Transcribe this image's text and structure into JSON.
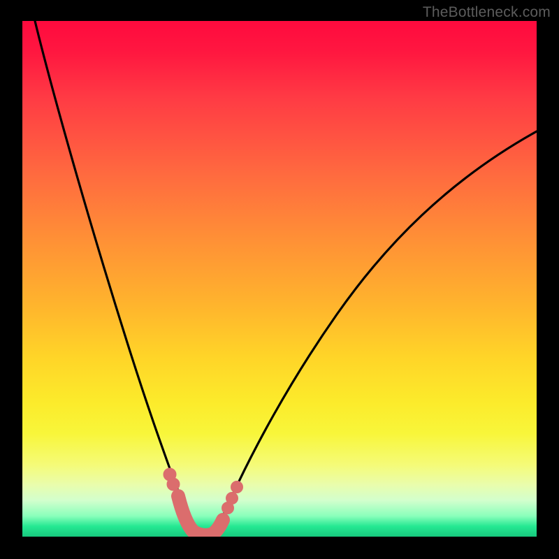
{
  "watermark": "TheBottleneck.com",
  "chart_data": {
    "type": "line",
    "title": "",
    "xlabel": "",
    "ylabel": "",
    "xlim": [
      0,
      100
    ],
    "ylim": [
      0,
      100
    ],
    "series": [
      {
        "name": "bottleneck-curve",
        "x": [
          2,
          5,
          10,
          15,
          20,
          25,
          27,
          29,
          30,
          31,
          32,
          33,
          34,
          35,
          36,
          38,
          42,
          50,
          60,
          70,
          80,
          90,
          100
        ],
        "y": [
          100,
          88,
          70,
          52,
          35,
          17,
          11,
          5,
          2,
          1,
          0,
          0,
          0,
          0,
          1,
          4,
          11,
          25,
          40,
          52,
          62,
          71,
          79
        ]
      }
    ],
    "markers": {
      "name": "highlight-points",
      "color": "#db6d6d",
      "points": [
        {
          "x": 27,
          "y": 11
        },
        {
          "x": 28,
          "y": 8
        },
        {
          "x": 29.5,
          "y": 3
        },
        {
          "x": 30.5,
          "y": 1
        },
        {
          "x": 32,
          "y": 0
        },
        {
          "x": 33.5,
          "y": 0
        },
        {
          "x": 35,
          "y": 0.5
        },
        {
          "x": 37,
          "y": 3
        },
        {
          "x": 38,
          "y": 5
        },
        {
          "x": 39,
          "y": 7
        },
        {
          "x": 40,
          "y": 9
        }
      ]
    },
    "colors": {
      "curve": "#000000",
      "marker": "#db6d6d",
      "gradient_top": "#ff0a3e",
      "gradient_bottom": "#17c97e"
    }
  }
}
